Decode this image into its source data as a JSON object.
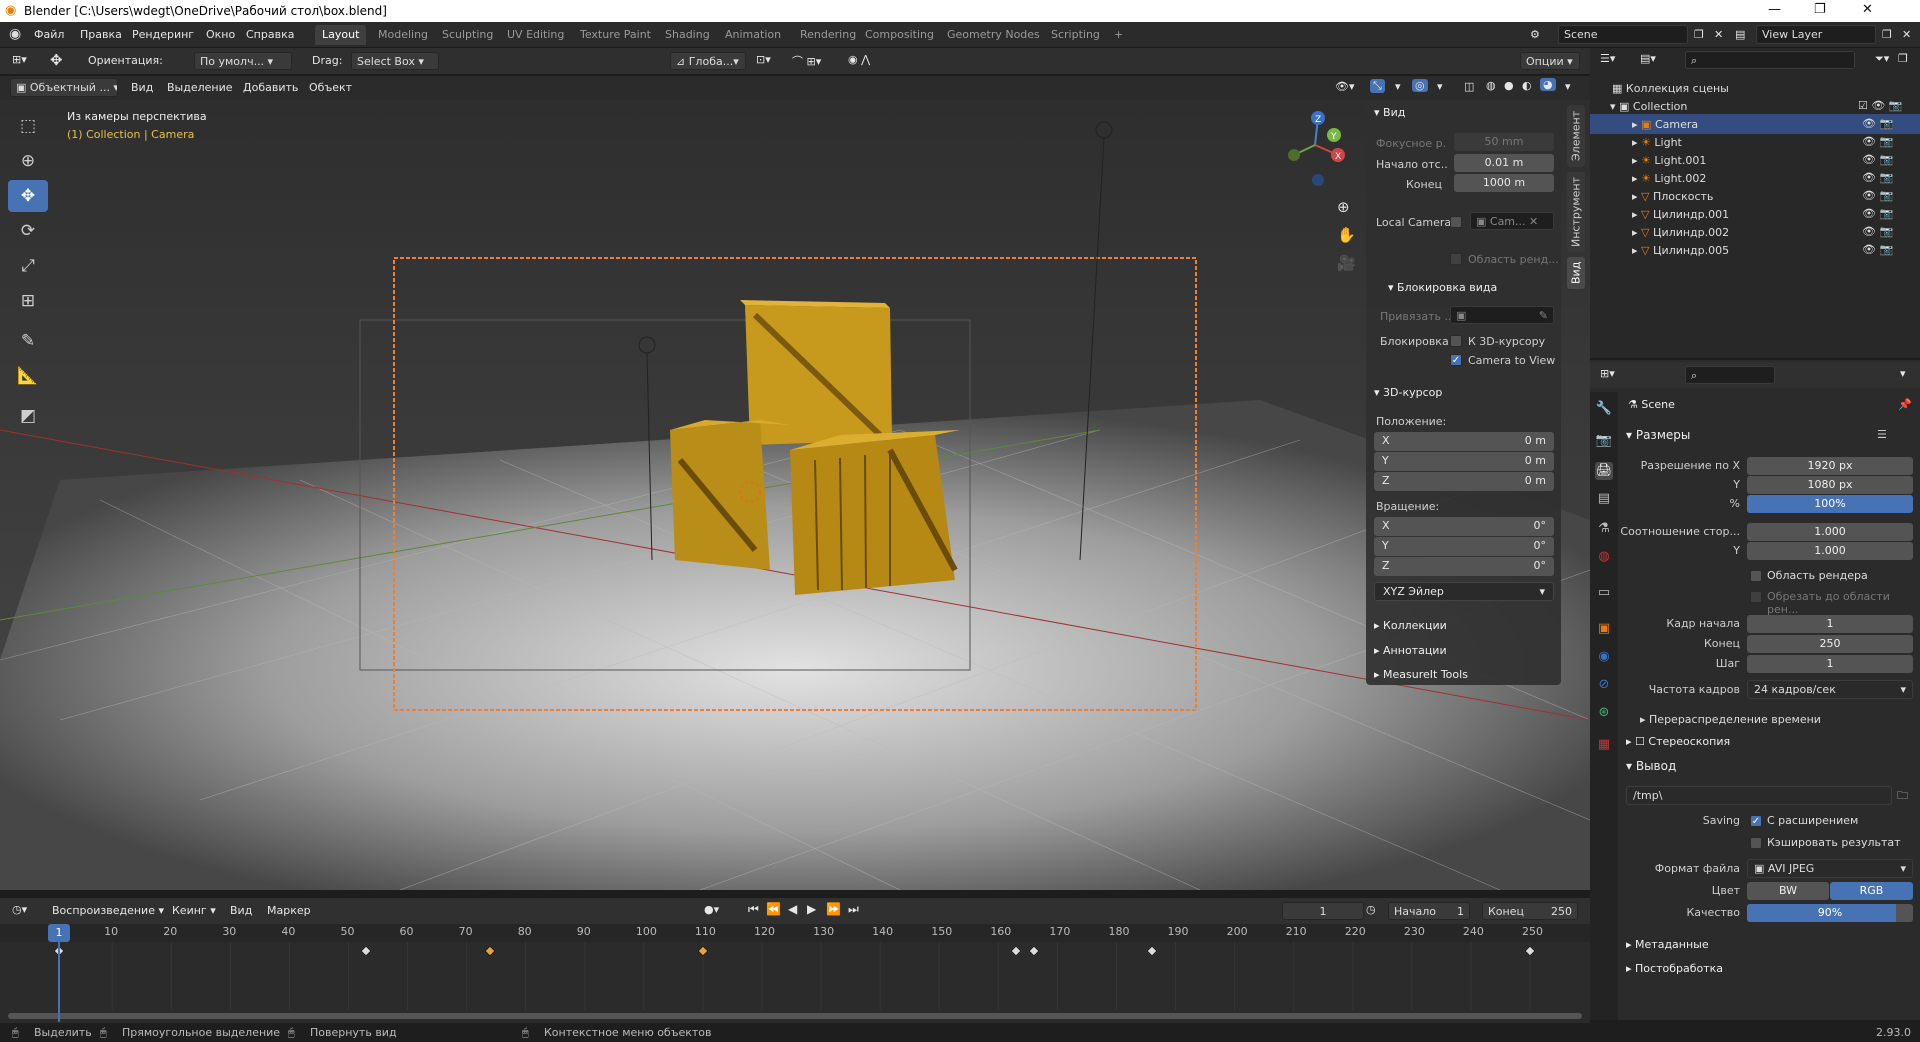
{
  "window": {
    "title": "Blender [C:\\Users\\wdegt\\OneDrive\\Рабочий стол\\box.blend]"
  },
  "menu": [
    "Файл",
    "Правка",
    "Рендеринг",
    "Окно",
    "Справка"
  ],
  "workspaces": [
    "Layout",
    "Modeling",
    "Sculpting",
    "UV Editing",
    "Texture Paint",
    "Shading",
    "Animation",
    "Rendering",
    "Compositing",
    "Geometry Nodes",
    "Scripting"
  ],
  "active_workspace": "Layout",
  "scene": {
    "name": "Scene",
    "view_layer": "View Layer"
  },
  "toolhead": {
    "orientation_label": "Ориентация:",
    "orientation_value": "По умолч...",
    "drag_label": "Drag:",
    "drag_value": "Select Box",
    "transform_value": "Глоба...",
    "options": "Опции"
  },
  "viewport_header": {
    "mode": "Объектный ...",
    "menus": [
      "Вид",
      "Выделение",
      "Добавить",
      "Объект"
    ]
  },
  "viewport": {
    "overlay_title": "Из камеры перспектива",
    "overlay_sub": "(1) Collection | Camera"
  },
  "npanel": {
    "tabs": [
      "Элемент",
      "Инструмент",
      "Вид"
    ],
    "view_section": "Вид",
    "focal_label": "Фокусное р...",
    "focal_value": "50 mm",
    "clip_start_label": "Начало отс...",
    "clip_start_value": "0.01 m",
    "clip_end_label": "Конец",
    "clip_end_value": "1000 m",
    "local_camera_label": "Local Camera",
    "local_camera_value": "Cam...",
    "render_region": "Область ренд...",
    "lock_section": "Блокировка вида",
    "lock_to_label": "Привязать ...",
    "lock_label": "Блокировка",
    "lock_cursor": "К 3D-курсору",
    "camera_to_view": "Camera to View",
    "cursor_section": "3D-курсор",
    "position_label": "Положение:",
    "loc": [
      {
        "axis": "X",
        "value": "0 m"
      },
      {
        "axis": "Y",
        "value": "0 m"
      },
      {
        "axis": "Z",
        "value": "0 m"
      }
    ],
    "rotation_label": "Вращение:",
    "rot": [
      {
        "axis": "X",
        "value": "0°"
      },
      {
        "axis": "Y",
        "value": "0°"
      },
      {
        "axis": "Z",
        "value": "0°"
      }
    ],
    "rot_mode": "XYZ Эйлер",
    "collapsed": [
      "Коллекции",
      "Аннотации",
      "MeasureIt Tools"
    ]
  },
  "outliner": {
    "root": "Коллекция сцены",
    "collection": "Collection",
    "items": [
      "Camera",
      "Light",
      "Light.001",
      "Light.002",
      "Плоскость",
      "Цилиндр.001",
      "Цилиндр.002",
      "Цилиндр.005"
    ]
  },
  "properties": {
    "scene": "Scene",
    "dimensions": "Размеры",
    "res_x_label": "Разрешение по X",
    "res_x": "1920 px",
    "res_y_label": "Y",
    "res_y": "1080 px",
    "res_pct_label": "%",
    "res_pct": "100%",
    "aspect_label": "Соотношение стор...",
    "aspect_x": "1.000",
    "aspect_y_label": "Y",
    "aspect_y": "1.000",
    "render_region": "Область рендера",
    "crop": "Обрезать до области рен...",
    "frame_start_label": "Кадр начала",
    "frame_start": "1",
    "frame_end_label": "Конец",
    "frame_end": "250",
    "frame_step_label": "Шаг",
    "frame_step": "1",
    "fps_label": "Частота кадров",
    "fps": "24 кадров/сек",
    "time_remap": "Перераспределение времени",
    "stereo": "Стереоскопия",
    "output": "Вывод",
    "output_path": "/tmp\\",
    "saving_label": "Saving",
    "ext": "С расширением",
    "cache": "Кэшировать результат",
    "format_label": "Формат файла",
    "format": "AVI JPEG",
    "color_label": "Цвет",
    "bw": "BW",
    "rgb": "RGB",
    "quality_label": "Качество",
    "quality": "90%",
    "quality_value": 0.9,
    "metadata": "Метаданные",
    "postprocess": "Постобработка"
  },
  "timeline": {
    "playback": "Воспроизведение",
    "keying": "Кеинг",
    "view": "Вид",
    "marker": "Маркер",
    "current": "1",
    "start_label": "Начало",
    "start": "1",
    "end_label": "Конец",
    "end": "250",
    "ticks": [
      "1",
      "10",
      "20",
      "30",
      "40",
      "50",
      "60",
      "70",
      "80",
      "90",
      "100",
      "110",
      "120",
      "130",
      "140",
      "150",
      "160",
      "170",
      "180",
      "190",
      "200",
      "210",
      "220",
      "230",
      "240",
      "250"
    ],
    "keyframes": [
      1,
      53,
      74,
      110,
      163,
      166,
      186,
      250
    ]
  },
  "status": {
    "select": "Выделить",
    "box": "Прямоугольное выделение",
    "rotate": "Повернуть вид",
    "context": "Контекстное меню объектов",
    "version": "2.93.0"
  }
}
